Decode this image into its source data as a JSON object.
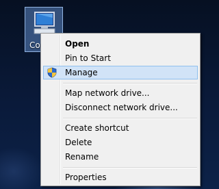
{
  "desktop": {
    "icon_label": "Computer"
  },
  "context_menu": {
    "items": [
      {
        "label": "Open"
      },
      {
        "label": "Pin to Start"
      },
      {
        "label": "Manage",
        "icon": "uac-shield-icon"
      },
      {
        "label": "Map network drive..."
      },
      {
        "label": "Disconnect network drive..."
      },
      {
        "label": "Create shortcut"
      },
      {
        "label": "Delete"
      },
      {
        "label": "Rename"
      },
      {
        "label": "Properties"
      }
    ]
  },
  "colors": {
    "menu_background": "#f0f0f0",
    "highlight_background": "#d1e3f7",
    "highlight_border": "#8fbfee",
    "desktop_selection": "#6ea0e6"
  }
}
